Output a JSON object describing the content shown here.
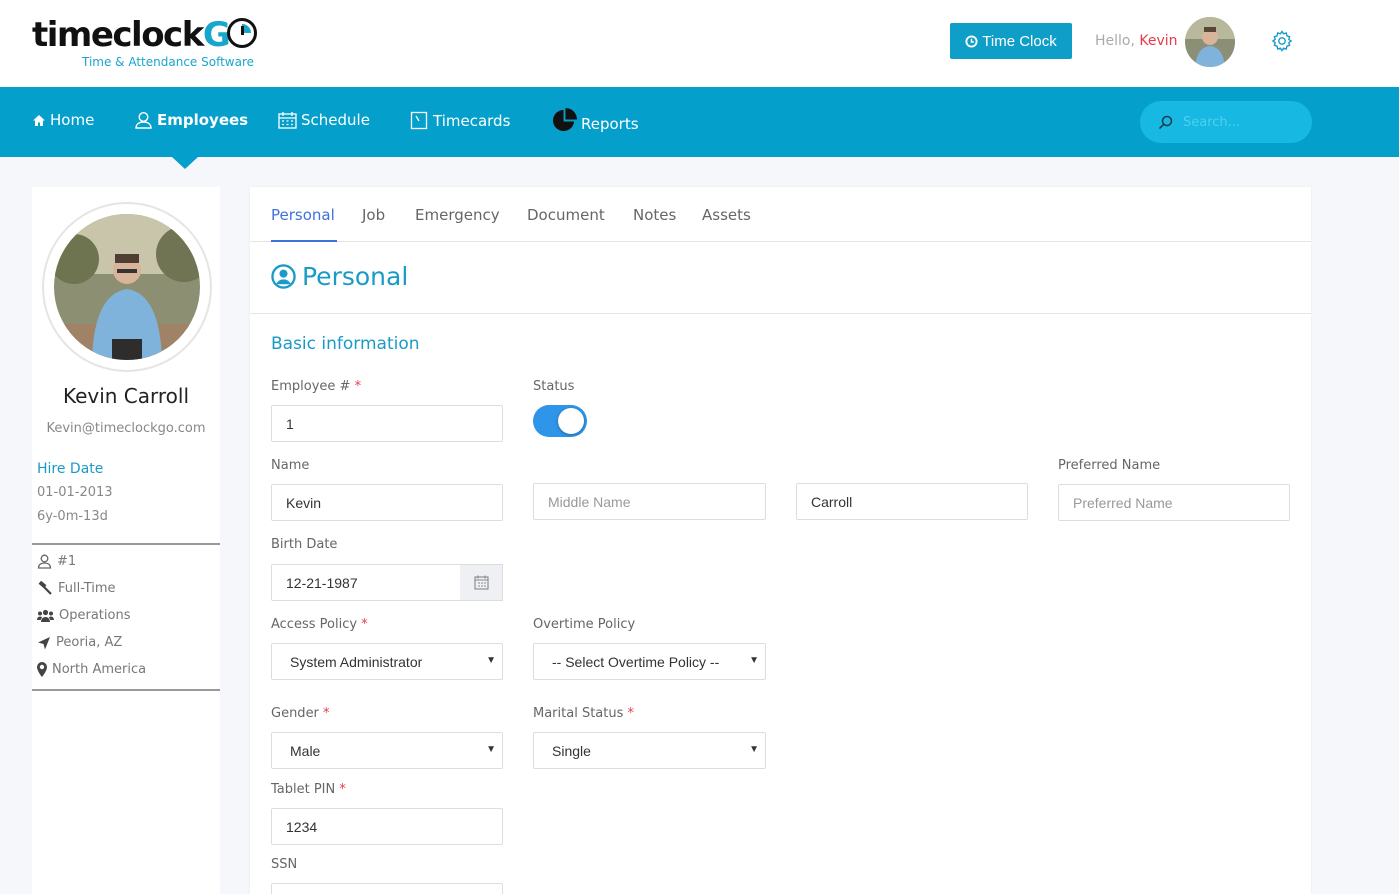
{
  "brand": {
    "logo_prefix": "timeclock",
    "logo_suffix": "G",
    "tagline": "Time & Attendance Software",
    "accent": "#04a0cb"
  },
  "header": {
    "time_clock_label": "Time Clock",
    "hello": "Hello,",
    "user": "Kevin"
  },
  "nav": {
    "items": [
      {
        "label": "Home",
        "icon": "home-icon"
      },
      {
        "label": "Employees",
        "icon": "employee-icon"
      },
      {
        "label": "Schedule",
        "icon": "calendar-icon"
      },
      {
        "label": "Timecards",
        "icon": "timecard-icon"
      },
      {
        "label": "Reports",
        "icon": "pie-chart-icon"
      }
    ],
    "active": "Employees",
    "search_placeholder": "Search..."
  },
  "profile": {
    "name": "Kevin Carroll",
    "email": "Kevin@timeclockgo.com",
    "hire_label": "Hire Date",
    "hire_date": "01-01-2013",
    "tenure": "6y-0m-13d",
    "emp_no": "#1",
    "type": "Full-Time",
    "department": "Operations",
    "location": "Peoria, AZ",
    "region": "North America"
  },
  "tabs": [
    "Personal",
    "Job",
    "Emergency",
    "Document",
    "Notes",
    "Assets"
  ],
  "section": {
    "title": "Personal",
    "subtitle": "Basic information"
  },
  "form": {
    "employee_no_label": "Employee #",
    "employee_no": "1",
    "status_label": "Status",
    "status_on": true,
    "name_label": "Name",
    "first_name": "Kevin",
    "middle_placeholder": "Middle Name",
    "last_name": "Carroll",
    "preferred_label": "Preferred Name",
    "preferred_placeholder": "Preferred Name",
    "birth_label": "Birth Date",
    "birth_date": "12-21-1987",
    "access_label": "Access Policy",
    "access_value": "System Administrator",
    "overtime_label": "Overtime Policy",
    "overtime_value": "-- Select Overtime Policy --",
    "gender_label": "Gender",
    "gender_value": "Male",
    "marital_label": "Marital Status",
    "marital_value": "Single",
    "pin_label": "Tablet PIN",
    "pin_value": "1234",
    "ssn_label": "SSN",
    "required_mark": "*"
  }
}
